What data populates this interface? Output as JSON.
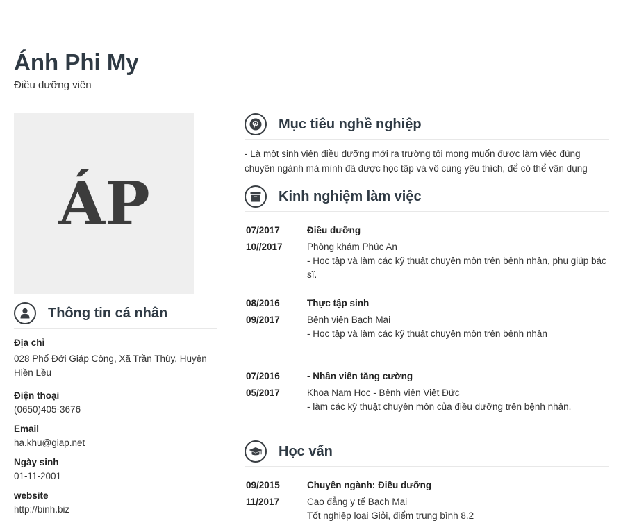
{
  "header": {
    "name": "Ánh Phi My",
    "title": "Điều dưỡng viên"
  },
  "avatar": {
    "initials": "ÁP"
  },
  "personal": {
    "heading": "Thông tin cá nhân",
    "fields": [
      {
        "label": "Địa chỉ",
        "value": "028 Phố Đới Giáp Công, Xã Trần Thùy, Huyện Hiền Lều"
      },
      {
        "label": "Điện thoại",
        "value": "(0650)405-3676"
      },
      {
        "label": "Email",
        "value": "ha.khu@giap.net"
      },
      {
        "label": "Ngày sinh",
        "value": "01-11-2001"
      },
      {
        "label": "website",
        "value": "http://binh.biz"
      }
    ]
  },
  "objective": {
    "heading": "Mục tiêu nghề nghiệp",
    "text": "- Là một sinh viên điều dưỡng mới ra trường tôi mong muốn được làm việc đúng chuyên ngành mà mình đã được học tập và vô cùng yêu thích, để có thể vận dụng"
  },
  "experience": {
    "heading": "Kinh nghiệm làm việc",
    "items": [
      {
        "start": "07/2017",
        "end": "10//2017",
        "position": "Điều dưỡng",
        "place": "Phòng khám Phúc An",
        "desc": "- Học tập và làm các kỹ thuật chuyên môn trên bệnh nhân, phụ giúp bác sĩ."
      },
      {
        "start": "08/2016",
        "end": "09/2017",
        "position": "Thực tập sinh",
        "place": "Bệnh viện Bạch Mai",
        "desc": "- Học tập và làm các kỹ thuật chuyên môn trên bệnh nhân"
      },
      {
        "start": "07/2016",
        "end": "05/2017",
        "position": "- Nhân viên tăng cường",
        "place": "Khoa Nam Học - Bệnh viện Việt Đức",
        "desc": "- làm các kỹ thuật chuyên môn của điều dưỡng trên bệnh nhân."
      }
    ]
  },
  "education": {
    "heading": "Học vấn",
    "items": [
      {
        "start": "09/2015",
        "end": "11/2017",
        "major": "Chuyên ngành: Điều dưỡng",
        "school": "Cao đẳng y tế Bạch Mai",
        "desc": "Tốt nghiệp loại Giỏi, điểm trung bình 8.2"
      }
    ]
  },
  "icons": {
    "personal": "user-icon",
    "objective": "pinterest-icon",
    "experience": "archive-box-icon",
    "education": "graduation-cap-icon"
  }
}
